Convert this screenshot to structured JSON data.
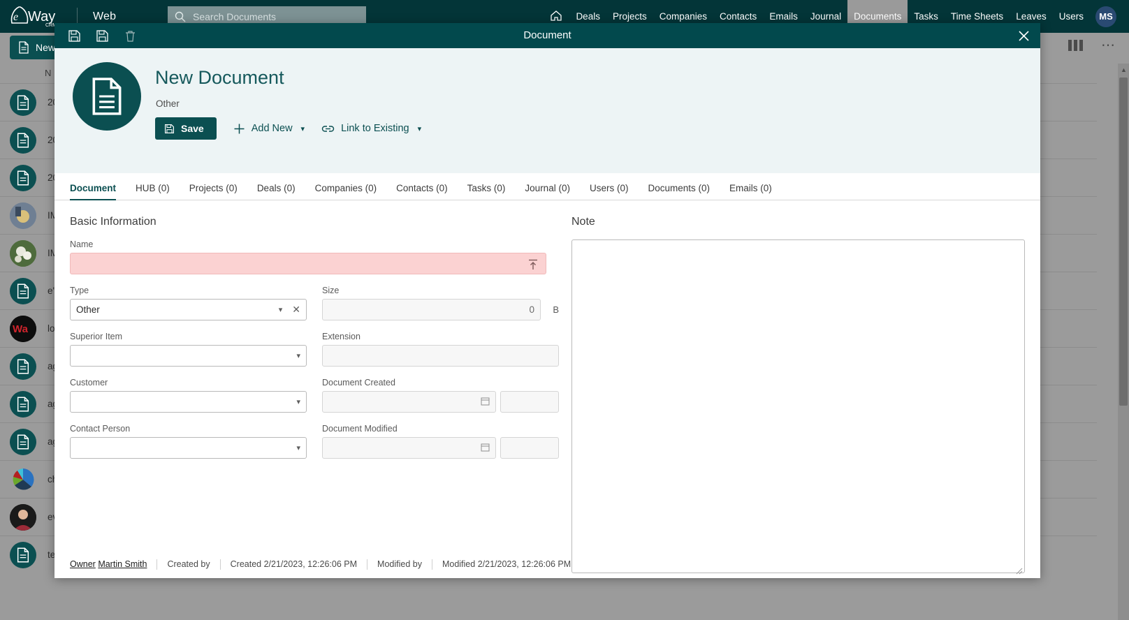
{
  "topnav": {
    "brand_text": "eWay",
    "brand_sub": "CRM",
    "app_label": "Web",
    "search": {
      "placeholder": "Search Documents",
      "value": ""
    },
    "links": [
      {
        "label": "Deals",
        "active": false
      },
      {
        "label": "Projects",
        "active": false
      },
      {
        "label": "Companies",
        "active": false
      },
      {
        "label": "Contacts",
        "active": false
      },
      {
        "label": "Emails",
        "active": false
      },
      {
        "label": "Journal",
        "active": false
      },
      {
        "label": "Documents",
        "active": true
      },
      {
        "label": "Tasks",
        "active": false
      },
      {
        "label": "Time Sheets",
        "active": false
      },
      {
        "label": "Leaves",
        "active": false
      },
      {
        "label": "Users",
        "active": false
      }
    ],
    "home_icon": "home-icon",
    "avatar_initials": "MS"
  },
  "background": {
    "new_button_label": "New",
    "column_header": "N",
    "rows": [
      {
        "text": "20",
        "avatar": "document-icon"
      },
      {
        "text": "20",
        "avatar": "document-icon"
      },
      {
        "text": "20",
        "avatar": "document-icon"
      },
      {
        "text": "IM",
        "avatar": "photo"
      },
      {
        "text": "IM",
        "avatar": "photo"
      },
      {
        "text": "e'",
        "avatar": "document-icon"
      },
      {
        "text": "lo",
        "avatar": "logo"
      },
      {
        "text": "ag",
        "avatar": "document-icon"
      },
      {
        "text": "ag",
        "avatar": "document-icon"
      },
      {
        "text": "ag",
        "avatar": "document-icon"
      },
      {
        "text": "ch",
        "avatar": "chart"
      },
      {
        "text": "ev",
        "avatar": "photo"
      },
      {
        "text": "te",
        "avatar": "document-icon"
      }
    ]
  },
  "modal": {
    "titlebar": {
      "title": "Document",
      "tools": [
        {
          "name": "save-and-new-icon",
          "label": "Save and New"
        },
        {
          "name": "save-icon",
          "label": "Save"
        },
        {
          "name": "delete-icon",
          "label": "Delete"
        }
      ],
      "close_label": "×"
    },
    "hero": {
      "icon": "document-icon",
      "title": "New Document",
      "subtitle": "Other",
      "save_label": "Save",
      "add_new_label": "Add New",
      "link_existing_label": "Link to Existing",
      "chevron": "▾"
    },
    "tabs": [
      {
        "label": "Document",
        "active": true
      },
      {
        "label": "HUB (0)",
        "active": false
      },
      {
        "label": "Projects (0)",
        "active": false
      },
      {
        "label": "Deals (0)",
        "active": false
      },
      {
        "label": "Companies (0)",
        "active": false
      },
      {
        "label": "Contacts (0)",
        "active": false
      },
      {
        "label": "Tasks (0)",
        "active": false
      },
      {
        "label": "Journal (0)",
        "active": false
      },
      {
        "label": "Users (0)",
        "active": false
      },
      {
        "label": "Documents (0)",
        "active": false
      },
      {
        "label": "Emails (0)",
        "active": false
      }
    ],
    "form": {
      "section_title": "Basic Information",
      "name": {
        "label": "Name",
        "value": "",
        "upload_icon": "upload-icon"
      },
      "type": {
        "label": "Type",
        "value": "Other"
      },
      "size": {
        "label": "Size",
        "value": "0",
        "unit": "B"
      },
      "superior_item": {
        "label": "Superior Item",
        "value": ""
      },
      "extension": {
        "label": "Extension",
        "value": ""
      },
      "customer": {
        "label": "Customer",
        "value": ""
      },
      "document_created": {
        "label": "Document Created",
        "date": "",
        "time": ""
      },
      "contact_person": {
        "label": "Contact Person",
        "value": ""
      },
      "document_modified": {
        "label": "Document Modified",
        "date": "",
        "time": ""
      }
    },
    "note": {
      "label": "Note",
      "value": ""
    },
    "footer": {
      "owner_label": "Owner",
      "owner_name": "Martin Smith",
      "created_by_label": "Created by",
      "created_by_value": "",
      "created_label": "Created",
      "created_value": "2/21/2023, 12:26:06 PM",
      "modified_by_label": "Modified by",
      "modified_by_value": "",
      "modified_label": "Modified",
      "modified_value": "2/21/2023, 12:26:06 PM"
    }
  },
  "colors": {
    "brand_dark": "#033538",
    "teal": "#0b4f51",
    "hero_bg": "#edf4f5",
    "error_bg": "#fbd2d2"
  }
}
